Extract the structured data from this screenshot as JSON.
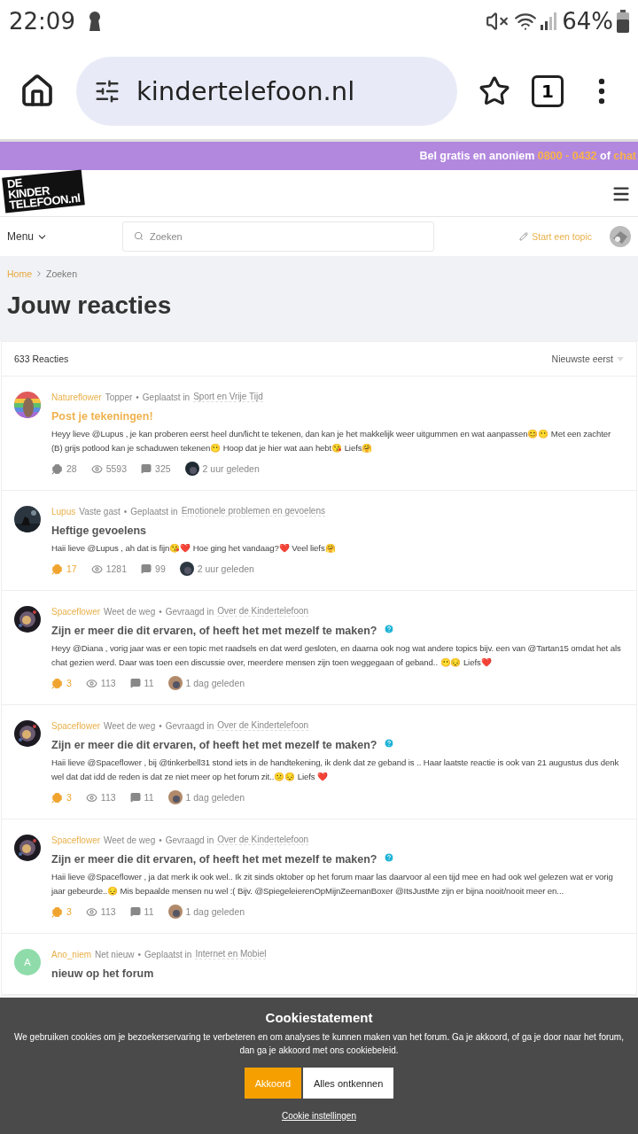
{
  "status_bar": {
    "time": "22:09",
    "battery": "64%"
  },
  "browser": {
    "url": "kindertelefoon.nl",
    "tab_count": "1"
  },
  "banner": {
    "parts": [
      {
        "text": "Bel gratis en anoniem ",
        "highlight": false
      },
      {
        "text": "0800 - 0432",
        "highlight": true
      },
      {
        "text": " of ",
        "highlight": false
      },
      {
        "text": "chat",
        "highlight": true
      }
    ]
  },
  "logo": {
    "lines": [
      "DE",
      "KINDER",
      "TELEFOON.nl"
    ]
  },
  "nav": {
    "menu": "Menu",
    "search_placeholder": "Zoeken",
    "start_topic": "Start een topic"
  },
  "breadcrumbs": [
    {
      "label": "Home",
      "link": true
    },
    {
      "label": "Zoeken",
      "link": false
    }
  ],
  "page_title": "Jouw reacties",
  "list_header": {
    "count": "633 Reacties",
    "sort": "Nieuwste eerst"
  },
  "posts": [
    {
      "author": "Natureflower",
      "rank": "Topper",
      "verb": "Geplaatst in",
      "category": "Sport en Vrije Tijd",
      "separator": "•",
      "title": "Post je tekeningen!",
      "highlighted": true,
      "question": false,
      "body": "Heyy lieve @Lupus , je kan proberen eerst heel dun/licht te tekenen, dan kan je het makkelijk weer uitgummen en wat aanpassen😊😶 Met een zachter (B) grijs potlood kan je schaduwen tekenen😶 Hoop dat je hier wat aan hebt😘 Liefs🤗",
      "likes": "28",
      "liked": false,
      "views": "5593",
      "replies": "325",
      "time": "2 uur geleden"
    },
    {
      "author": "Lupus",
      "rank": "Vaste gast",
      "verb": "Geplaatst in",
      "category": "Emotionele problemen en gevoelens",
      "separator": "•",
      "title": "Heftige gevoelens",
      "highlighted": false,
      "question": false,
      "body": "Haii lieve @Lupus , ah dat is fijn😘❤️ Hoe ging het vandaag?❤️ Veel liefs🤗",
      "likes": "17",
      "liked": true,
      "views": "1281",
      "replies": "99",
      "time": "2 uur geleden"
    },
    {
      "author": "Spaceflower",
      "rank": "Weet de weg",
      "separator": "•",
      "verb": "Gevraagd in",
      "category": "Over de Kindertelefoon",
      "title": "Zijn er meer die dit ervaren, of heeft het met mezelf te maken?",
      "highlighted": false,
      "question": true,
      "body": "Heyy @Diana , vorig jaar was er een topic met raadsels en dat werd gesloten, en daarna ook nog wat andere topics bijv. een van @Tartan15 omdat het als chat gezien werd. Daar was toen een discussie over, meerdere mensen zijn toen weggegaan of geband.. 😶😔 Liefs❤️",
      "likes": "3",
      "liked": true,
      "views": "113",
      "replies": "11",
      "time": "1 dag geleden"
    },
    {
      "author": "Spaceflower",
      "rank": "Weet de weg",
      "separator": "•",
      "verb": "Gevraagd in",
      "category": "Over de Kindertelefoon",
      "title": "Zijn er meer die dit ervaren, of heeft het met mezelf te maken?",
      "highlighted": false,
      "question": true,
      "body": "Haii lieve @Spaceflower , bij @tinkerbell31 stond iets in de handtekening, ik denk dat ze geband is .. Haar laatste reactie is ook van 21 augustus dus denk wel dat dat idd de reden is dat ze niet meer op het forum zit..😕😔 Liefs ❤️",
      "likes": "3",
      "liked": true,
      "views": "113",
      "replies": "11",
      "time": "1 dag geleden"
    },
    {
      "author": "Spaceflower",
      "rank": "Weet de weg",
      "separator": "•",
      "verb": "Gevraagd in",
      "category": "Over de Kindertelefoon",
      "title": "Zijn er meer die dit ervaren, of heeft het met mezelf te maken?",
      "highlighted": false,
      "question": true,
      "body": "Haii lieve @Spaceflower , ja dat merk ik ook wel.. Ik zit sinds oktober op het forum maar las daarvoor al een tijd mee en had ook wel gelezen wat er vorig jaar gebeurde..😔 Mis bepaalde mensen nu wel :( Bijv. @SpiegeleierenOpMijnZeemanBoxer @ItsJustMe zijn er bijna nooit/nooit meer en...",
      "likes": "3",
      "liked": true,
      "views": "113",
      "replies": "11",
      "time": "1 dag geleden"
    },
    {
      "author": "Ano_niem",
      "rank": "Net nieuw",
      "verb": "Geplaatst in",
      "category": "Internet en Mobiel",
      "separator": "•",
      "letter": "A",
      "title": "nieuw op het forum",
      "highlighted": false
    }
  ],
  "cookie": {
    "title": "Cookiestatement",
    "text": "We gebruiken cookies om je bezoekerservaring te verbeteren en om analyses te kunnen maken van het forum. Ga je akkoord, of ga je door naar het forum, dan ga je akkoord met ons cookiebeleid.",
    "accept": "Akkoord",
    "reject": "Alles ontkennen",
    "settings": "Cookie instellingen"
  }
}
